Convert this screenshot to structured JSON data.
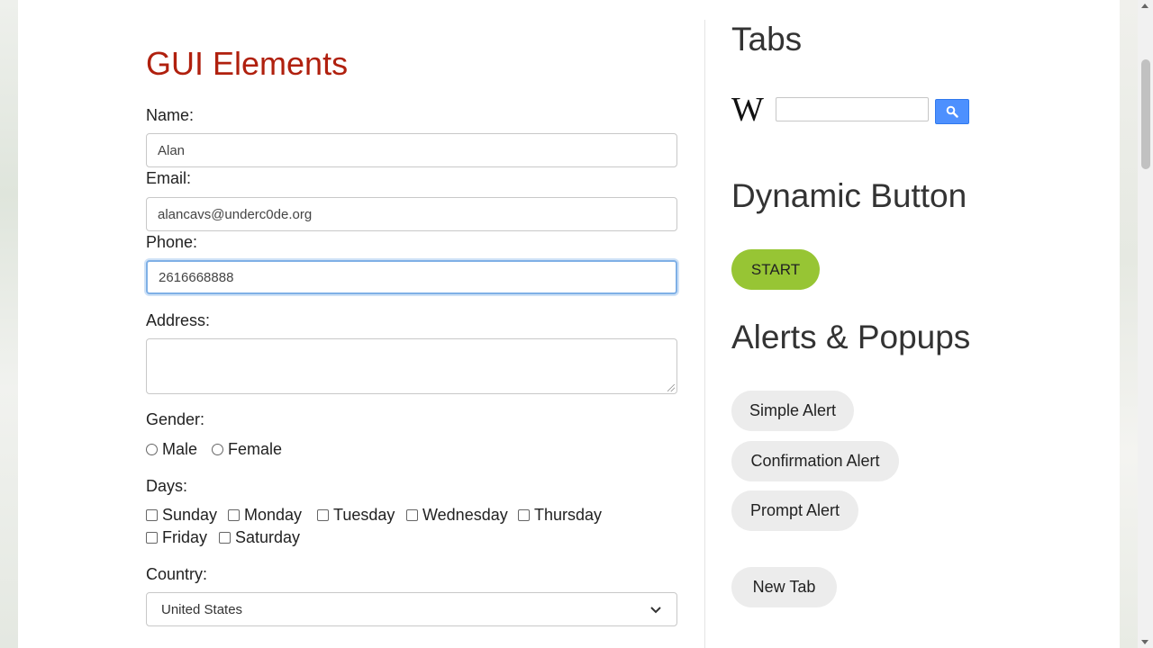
{
  "page": {
    "title": "GUI Elements"
  },
  "form": {
    "name_label": "Name:",
    "name_value": "Alan",
    "email_label": "Email:",
    "email_value": "alancavs@underc0de.org",
    "phone_label": "Phone:",
    "phone_value": "2616668888",
    "address_label": "Address:",
    "address_value": "",
    "gender_label": "Gender:",
    "gender_options": [
      "Male",
      "Female"
    ],
    "days_label": "Days:",
    "days": [
      "Sunday",
      "Monday",
      "Tuesday",
      "Wednesday",
      "Thursday",
      "Friday",
      "Saturday"
    ],
    "country_label": "Country:",
    "country_value": "United States"
  },
  "sidebar": {
    "tabs_heading": "Tabs",
    "wiki_logo": "W",
    "wiki_search_value": "",
    "dynamic_heading": "Dynamic Button",
    "start_label": "START",
    "alerts_heading": "Alerts & Popups",
    "simple_alert": "Simple Alert",
    "confirmation_alert": "Confirmation Alert",
    "prompt_alert": "Prompt Alert",
    "new_tab": "New Tab"
  },
  "colors": {
    "title": "#b0200e",
    "start_button": "#97c534",
    "search_button": "#4d90fe",
    "pill": "#ececec"
  },
  "icons": {
    "search": "search-icon",
    "dropdown": "chevron-down-icon",
    "wikipedia": "wikipedia-logo"
  }
}
